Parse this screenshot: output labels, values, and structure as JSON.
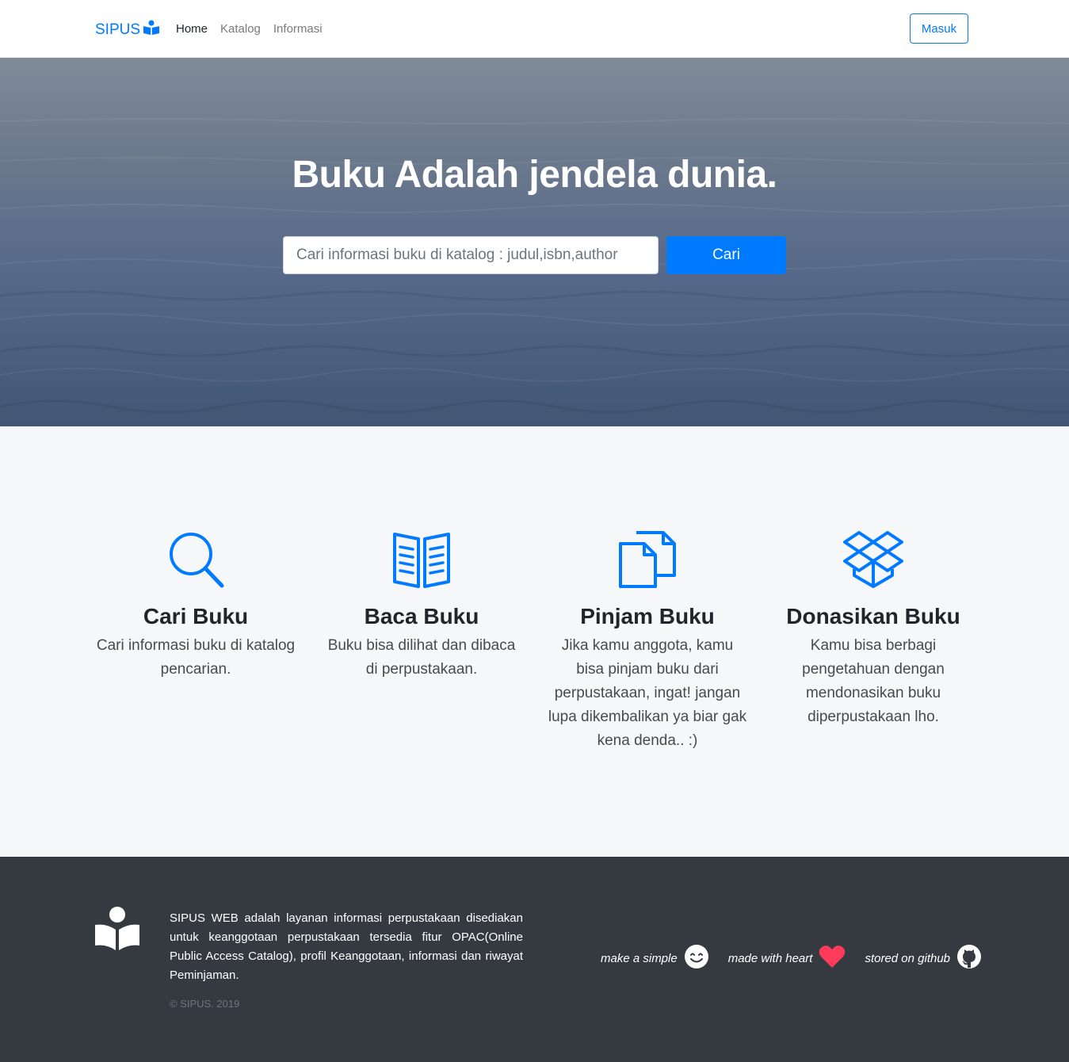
{
  "navbar": {
    "brand": "SIPUS",
    "links": [
      {
        "label": "Home",
        "active": true
      },
      {
        "label": "Katalog",
        "active": false
      },
      {
        "label": "Informasi",
        "active": false
      }
    ],
    "login_label": "Masuk"
  },
  "hero": {
    "title": "Buku Adalah jendela dunia.",
    "search_placeholder": "Cari informasi buku di katalog : judul,isbn,author",
    "search_button": "Cari"
  },
  "features": [
    {
      "icon": "search-icon",
      "title": "Cari Buku",
      "desc": "Cari informasi buku di katalog pencarian."
    },
    {
      "icon": "open-book-icon",
      "title": "Baca Buku",
      "desc": "Buku bisa dilihat dan dibaca di perpustakaan."
    },
    {
      "icon": "documents-icon",
      "title": "Pinjam Buku",
      "desc": "Jika kamu anggota, kamu bisa pinjam buku dari perpustakaan, ingat! jangan lupa dikembalikan ya biar gak kena denda.. :)"
    },
    {
      "icon": "dropbox-icon",
      "title": "Donasikan Buku",
      "desc": "Kamu bisa berbagi pengetahuan dengan mendonasikan buku diperpustakaan lho."
    }
  ],
  "footer": {
    "about": "SIPUS WEB adalah layanan informasi perpustakaan disediakan untuk keanggotaan perpustakaan tersedia fitur OPAC(Online Public Access Catalog), profil Keanggotaan, informasi dan riwayat Peminjaman.",
    "copyright": "© SIPUS. 2019",
    "links": [
      {
        "label": "make a simple",
        "icon": "smile-icon"
      },
      {
        "label": "made with heart",
        "icon": "heart-icon"
      },
      {
        "label": "stored on github",
        "icon": "github-icon"
      }
    ]
  },
  "colors": {
    "primary": "#007bff",
    "footer_bg": "#343a40",
    "features_bg": "#f6f7f9",
    "heart": "#ff3b5c"
  }
}
